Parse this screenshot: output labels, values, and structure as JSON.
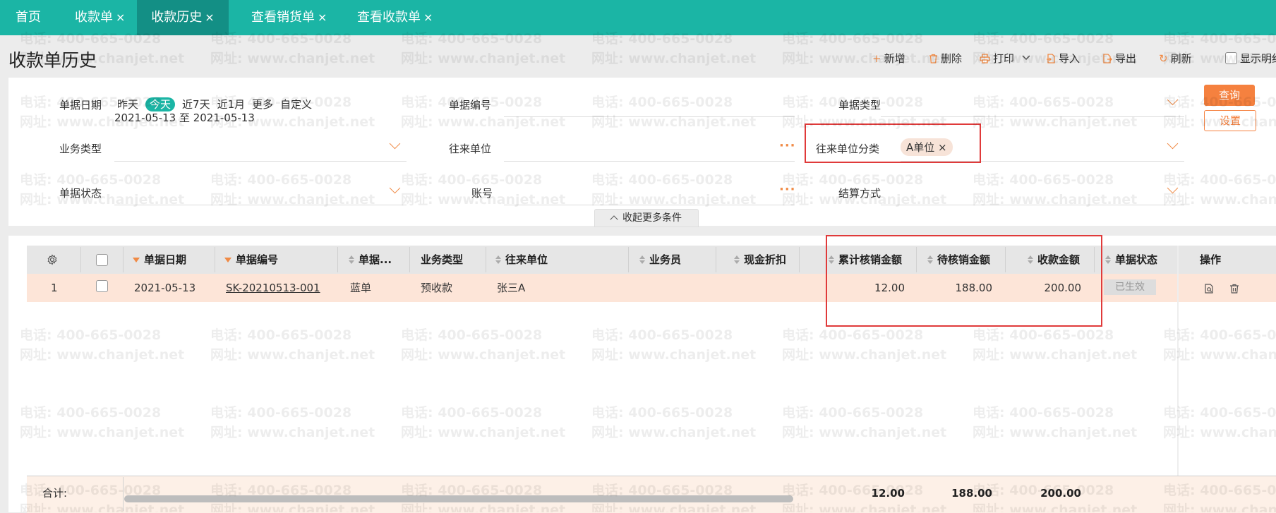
{
  "tabs": [
    {
      "label": "首页",
      "closable": false,
      "active": false
    },
    {
      "label": "收款单",
      "closable": true,
      "active": false
    },
    {
      "label": "收款历史",
      "closable": true,
      "active": true
    },
    {
      "label": "查看销货单",
      "closable": true,
      "active": false
    },
    {
      "label": "查看收款单",
      "closable": true,
      "active": false
    }
  ],
  "close_glyph": "×",
  "page": {
    "title": "收款单历史"
  },
  "toolbar": {
    "add": "新增",
    "delete": "删除",
    "print": "打印",
    "import": "导入",
    "export": "导出",
    "refresh": "刷新",
    "show_detail": "显示明细"
  },
  "filters": {
    "date_label": "单据日期",
    "quick_dates": [
      "昨天",
      "今天",
      "近7天",
      "近1月",
      "更多",
      "自定义"
    ],
    "quick_selected": "今天",
    "date_range": "2021-05-13 至 2021-05-13",
    "code_label": "单据编号",
    "doc_type_label": "单据类型",
    "biz_type_label": "业务类型",
    "partner_label": "往来单位",
    "partner_category_label": "往来单位分类",
    "partner_category_chip": "A单位",
    "status_label": "单据状态",
    "account_label": "账号",
    "settlement_label": "结算方式",
    "query_button": "查询",
    "settings_button": "设置",
    "collapse_label": "收起更多条件"
  },
  "table": {
    "columns": [
      "单据日期",
      "单据编号",
      "单据...",
      "业务类型",
      "往来单位",
      "业务员",
      "现金折扣",
      "累计核销金额",
      "待核销金额",
      "收款金额",
      "单据状态",
      "操作"
    ],
    "rows": [
      {
        "index": "1",
        "date": "2021-05-13",
        "code": "SK-20210513-001",
        "doc_kind": "蓝单",
        "biz_type": "预收款",
        "partner": "张三A",
        "salesperson": "",
        "cash_discount": "",
        "verified_total": "12.00",
        "pending": "188.00",
        "amount": "200.00",
        "status": "已生效"
      }
    ],
    "totals": {
      "label": "合计:",
      "verified_total": "12.00",
      "pending": "188.00",
      "amount": "200.00"
    }
  },
  "watermark": {
    "phone": "电话: 400-665-0028",
    "url": "网址: www.chanjet.net"
  },
  "colors": {
    "brand_teal": "#1bb5a5",
    "active_tab": "#138f85",
    "accent_orange": "#f5813f",
    "highlight_row": "#fde5d8",
    "annotation_red": "#e03a3a"
  }
}
